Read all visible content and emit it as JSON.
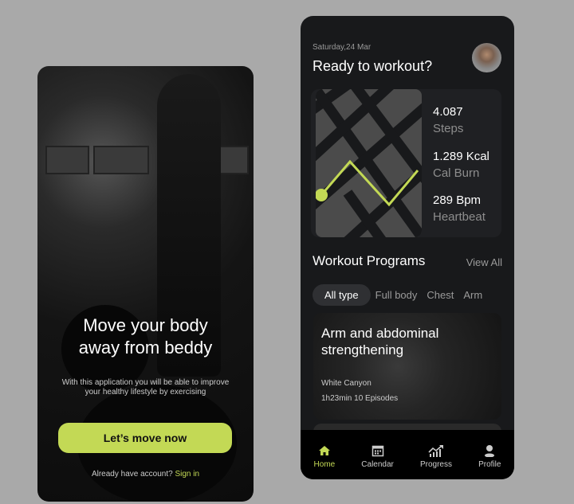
{
  "onboarding": {
    "title_line1": "Move your body",
    "title_line2": "away from beddy",
    "subtitle_line1": "With this application you will be able to improve",
    "subtitle_line2": "your healthy lifestyle by exercising",
    "cta_label": "Let’s move now",
    "signin_prompt": "Already have account?",
    "signin_link": "Sign in"
  },
  "home": {
    "date": "Saturday,24 Mar",
    "greeting": "Ready to workout?",
    "stats": [
      {
        "value": "4.087",
        "label": "Steps"
      },
      {
        "value": "1.289 Kcal",
        "label": "Cal Burn"
      },
      {
        "value": "289 Bpm",
        "label": "Heartbeat"
      }
    ],
    "section_title": "Workout Programs",
    "view_all": "View All",
    "chips": [
      "All type",
      "Full body",
      "Chest",
      "Arm"
    ],
    "program": {
      "title_line1": "Arm and abdominal",
      "title_line2": "strengthening",
      "author": "White Canyon",
      "details": "1h23min 10 Episodes"
    },
    "nav": [
      {
        "label": "Home",
        "icon": "home-icon",
        "active": true
      },
      {
        "label": "Calendar",
        "icon": "calendar-icon"
      },
      {
        "label": "Progress",
        "icon": "progress-chart-icon"
      },
      {
        "label": "Profile",
        "icon": "profile-icon"
      }
    ]
  },
  "colors": {
    "accent": "#c3d955",
    "background": "#18191b",
    "canvas": "#a9a9a9"
  }
}
